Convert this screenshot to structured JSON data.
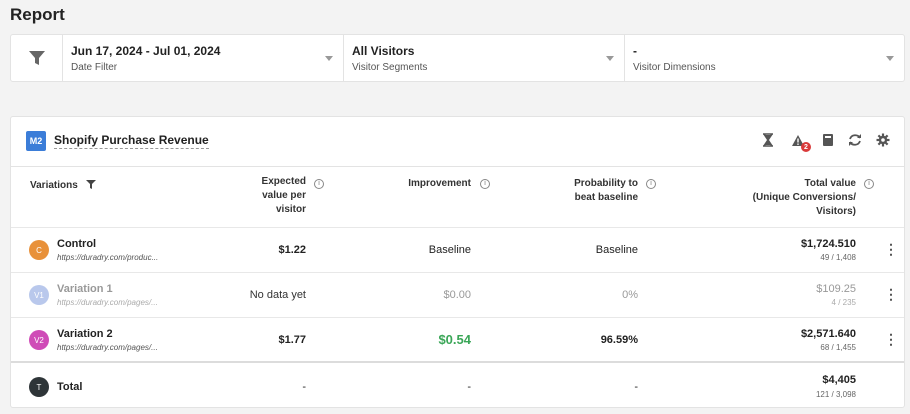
{
  "page": {
    "title": "Report"
  },
  "filters": {
    "date": {
      "value": "Jun 17, 2024 - Jul 01, 2024",
      "label": "Date Filter"
    },
    "segments": {
      "value": "All Visitors",
      "label": "Visitor Segments"
    },
    "dimensions": {
      "value": "-",
      "label": "Visitor Dimensions"
    }
  },
  "metric": {
    "badge": "M2",
    "name": "Shopify Purchase Revenue",
    "error_count": "2"
  },
  "table": {
    "headers": {
      "variations": "Variations",
      "expected_line1": "Expected",
      "expected_line2": "value per",
      "expected_line3": "visitor",
      "improvement": "Improvement",
      "probability_line1": "Probability to",
      "probability_line2": "beat baseline",
      "total_line1": "Total value",
      "total_line2": "(Unique Conversions/",
      "total_line3": "Visitors)"
    },
    "rows": [
      {
        "avatar": "C",
        "name": "Control",
        "url": "https://duradry.com/produc...",
        "expected": "$1.22",
        "improvement": "Baseline",
        "probability": "Baseline",
        "total": "$1,724.510",
        "ratio": "49 / 1,408",
        "avatar_color": "#e8913a"
      },
      {
        "avatar": "V1",
        "name": "Variation 1",
        "url": "https://duradry.com/pages/...",
        "expected": "No data yet",
        "improvement": "$0.00",
        "probability": "0%",
        "total": "$109.25",
        "ratio": "4 / 235",
        "avatar_color": "#b9c8ec"
      },
      {
        "avatar": "V2",
        "name": "Variation 2",
        "url": "https://duradry.com/pages/...",
        "expected": "$1.77",
        "improvement": "$0.54",
        "probability": "96.59%",
        "total": "$2,571.640",
        "ratio": "68 / 1,455",
        "avatar_color": "#cf4bb7"
      }
    ],
    "total_row": {
      "avatar": "T",
      "name": "Total",
      "expected": "-",
      "improvement": "-",
      "probability": "-",
      "total": "$4,405",
      "ratio": "121 / 3,098"
    }
  },
  "colors": {
    "accent_blue": "#3b7dd8",
    "positive_green": "#3aa657",
    "error_red": "#d93a3a"
  },
  "icons": [
    "filter-icon",
    "hourglass-icon",
    "warning-icon",
    "notebook-icon",
    "refresh-icon",
    "gear-icon",
    "kebab-icon"
  ]
}
